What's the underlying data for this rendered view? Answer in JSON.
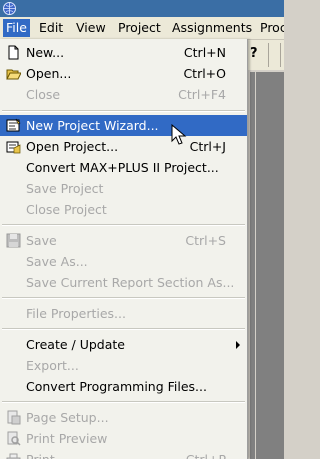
{
  "menubar": {
    "items": [
      {
        "label": "File",
        "selected": true
      },
      {
        "label": "Edit"
      },
      {
        "label": "View"
      },
      {
        "label": "Project"
      },
      {
        "label": "Assignments"
      },
      {
        "label": "Proc"
      }
    ]
  },
  "toolbar": {
    "help_glyph": "?"
  },
  "file_menu": {
    "items": [
      {
        "label": "New...",
        "shortcut": "Ctrl+N",
        "icon": "new-document-icon",
        "enabled": true
      },
      {
        "label": "Open...",
        "shortcut": "Ctrl+O",
        "icon": "open-folder-icon",
        "enabled": true
      },
      {
        "label": "Close",
        "shortcut": "Ctrl+F4",
        "enabled": false
      },
      {
        "label": "New Project Wizard...",
        "icon": "project-wizard-icon",
        "enabled": true,
        "highlighted": true
      },
      {
        "label": "Open Project...",
        "shortcut": "Ctrl+J",
        "icon": "open-project-icon",
        "enabled": true
      },
      {
        "label": "Convert MAX+PLUS II Project...",
        "enabled": true
      },
      {
        "label": "Save Project",
        "enabled": false
      },
      {
        "label": "Close Project",
        "enabled": false
      },
      {
        "label": "Save",
        "shortcut": "Ctrl+S",
        "icon": "save-disk-icon",
        "enabled": false
      },
      {
        "label": "Save As...",
        "enabled": false
      },
      {
        "label": "Save Current Report Section As...",
        "enabled": false
      },
      {
        "label": "File Properties...",
        "enabled": false
      },
      {
        "label": "Create / Update",
        "enabled": true,
        "submenu": true
      },
      {
        "label": "Export...",
        "enabled": false
      },
      {
        "label": "Convert Programming Files...",
        "enabled": true
      },
      {
        "label": "Page Setup...",
        "icon": "page-setup-icon",
        "enabled": false
      },
      {
        "label": "Print Preview",
        "icon": "print-preview-icon",
        "enabled": false
      },
      {
        "label": "Print",
        "shortcut": "Ctrl+P",
        "icon": "printer-icon",
        "enabled": false
      }
    ]
  },
  "colors": {
    "selection": "#316ac5",
    "disabled_text": "#a8a8a8",
    "menu_bg": "#f2f2ec"
  }
}
